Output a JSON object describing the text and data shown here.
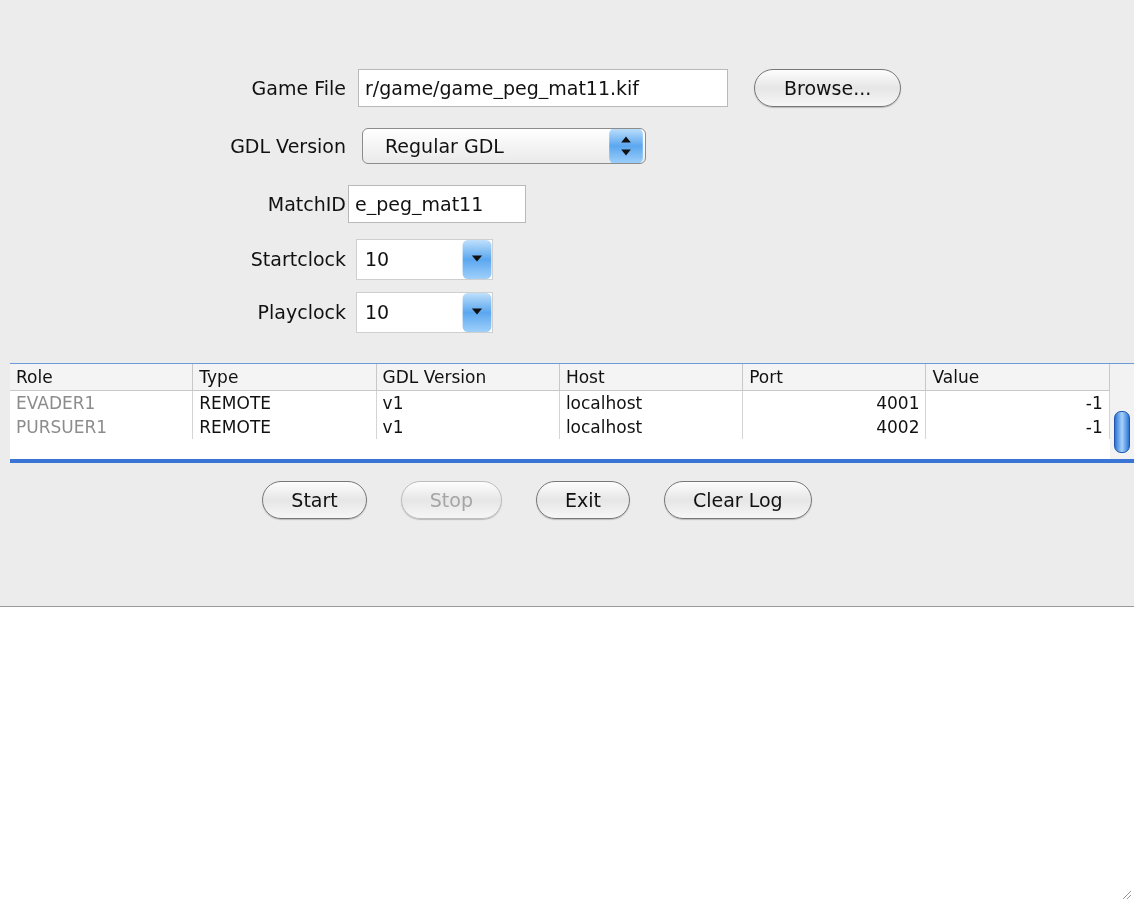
{
  "form": {
    "game_file": {
      "label": "Game File",
      "value": "r/game/game_peg_mat11.kif",
      "browse_button": "Browse..."
    },
    "gdl_version": {
      "label": "GDL Version",
      "value": "Regular GDL"
    },
    "match_id": {
      "label": "MatchID",
      "value": "e_peg_mat11"
    },
    "startclock": {
      "label": "Startclock",
      "value": "10"
    },
    "playclock": {
      "label": "Playclock",
      "value": "10"
    }
  },
  "table": {
    "columns": [
      "Role",
      "Type",
      "GDL Version",
      "Host",
      "Port",
      "Value"
    ],
    "rows": [
      {
        "cells": [
          "EVADER1",
          "REMOTE",
          "v1",
          "localhost",
          "4001",
          "-1"
        ]
      },
      {
        "cells": [
          "PURSUER1",
          "REMOTE",
          "v1",
          "localhost",
          "4002",
          "-1"
        ]
      }
    ]
  },
  "buttons": [
    {
      "label": "Start",
      "disabled": false
    },
    {
      "label": "Stop",
      "disabled": true
    },
    {
      "label": "Exit",
      "disabled": false
    },
    {
      "label": "Clear Log",
      "disabled": false
    }
  ]
}
